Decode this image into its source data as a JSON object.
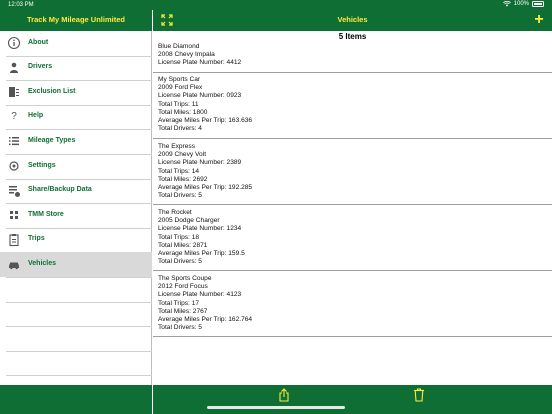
{
  "status_bar": {
    "time": "12:03 PM",
    "battery": "100%"
  },
  "left_header": {
    "title": "Track My Mileage Unlimited"
  },
  "right_header": {
    "title": "Vehicles"
  },
  "sidebar": {
    "items": [
      {
        "label": "About",
        "icon": "info-icon"
      },
      {
        "label": "Drivers",
        "icon": "person-icon"
      },
      {
        "label": "Exclusion List",
        "icon": "exclusion-list-icon"
      },
      {
        "label": "Help",
        "icon": "question-icon"
      },
      {
        "label": "Mileage Types",
        "icon": "list-icon"
      },
      {
        "label": "Settings",
        "icon": "gear-icon"
      },
      {
        "label": "Share/Backup Data",
        "icon": "share-backup-icon"
      },
      {
        "label": "TMM Store",
        "icon": "store-icon"
      },
      {
        "label": "Trips",
        "icon": "clipboard-icon"
      },
      {
        "label": "Vehicles",
        "icon": "car-icon",
        "selected": true
      }
    ]
  },
  "main": {
    "count_label": "5 Items",
    "vehicles": [
      {
        "name": "Blue Diamond",
        "model": "2008 Chevy Impala",
        "plate": "License Plate Number: 4412"
      },
      {
        "name": "My Sports Car",
        "model": "2009 Ford Flex",
        "plate": "License Plate Number: 0923",
        "trips": "Total Trips: 11",
        "miles": "Total Miles: 1800",
        "avg": "Average Miles Per Trip: 163.636",
        "drivers": "Total Drivers: 4"
      },
      {
        "name": "The Express",
        "model": "2009 Chevy Volt",
        "plate": "License Plate Number: 2389",
        "trips": "Total Trips: 14",
        "miles": "Total Miles: 2692",
        "avg": "Average Miles Per Trip: 192.285",
        "drivers": "Total Drivers: 5"
      },
      {
        "name": "The Rocket",
        "model": "2005 Dodge Charger",
        "plate": "License Plate Number: 1234",
        "trips": "Total Trips: 18",
        "miles": "Total Miles: 2871",
        "avg": "Average Miles Per Trip: 159.5",
        "drivers": "Total Drivers: 5"
      },
      {
        "name": "The Sports Coupe",
        "model": "2012 Ford Focus",
        "plate": "License Plate Number: 4123",
        "trips": "Total Trips: 17",
        "miles": "Total Miles: 2767",
        "avg": "Average Miles Per Trip: 162.764",
        "drivers": "Total Drivers: 5"
      }
    ]
  },
  "toolbar": {
    "share": "share-icon",
    "trash": "trash-icon"
  },
  "colors": {
    "bar": "#0f6e34",
    "title": "#ffeb3b",
    "label": "#0f6e34",
    "selected": "#d9d9d9"
  }
}
